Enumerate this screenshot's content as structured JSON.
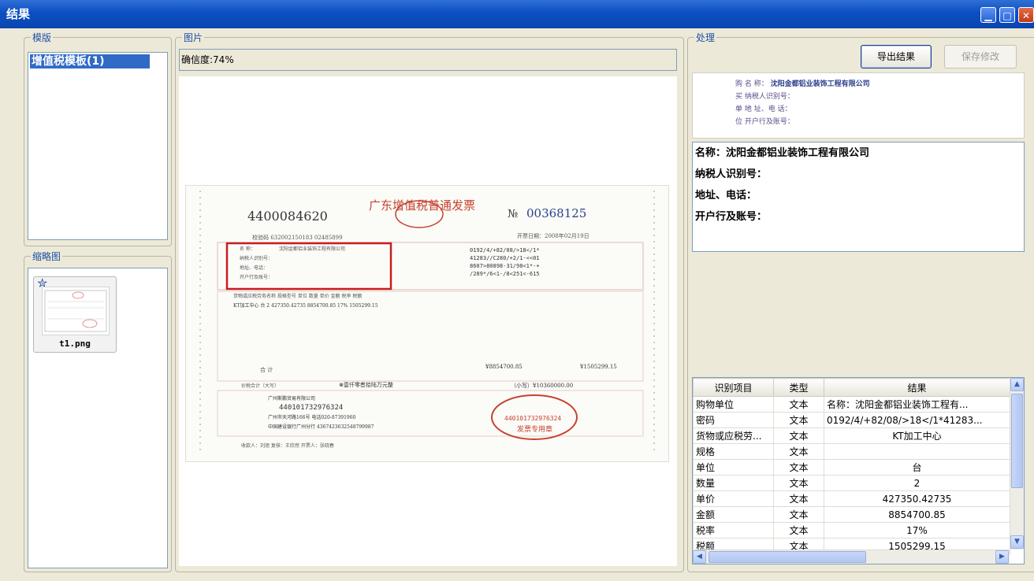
{
  "window": {
    "title": "结果",
    "min_glyph": "▁",
    "max_glyph": "□",
    "close_glyph": "✕"
  },
  "templates": {
    "label": "模版",
    "items": [
      "增值税模板(1)"
    ]
  },
  "thumbnails": {
    "label": "缩略图",
    "items": [
      {
        "caption": "t1.png"
      }
    ]
  },
  "image": {
    "label": "图片",
    "confidence_text": "确信度:74%",
    "invoice": {
      "code": "4400084620",
      "title": "广东增值税普通发票",
      "number_prefix": "№",
      "number": "00368125",
      "check_code": "校验码 632002150183 02485899",
      "date": "开票日期：2008年02月19日",
      "buyer_name_label": "名 称：",
      "buyer_name_value": "沈阳金都铝业装饰工程有限公司",
      "buyer_tax_label": "纳税人识别号：",
      "buyer_addr_label": "地址、电话：",
      "buyer_bank_label": "开户行及账号：",
      "cipher_lines": [
        "0192/4/+82/08/>18</1*",
        "41283//C280/+2/1-<<01",
        "8607>80898-31/98<1*-+",
        "/289*/6<1-/8<251<-615"
      ],
      "item_header": "货物或应税劳务名称    规格型号   单位   数量   单价      金额        税率   税额",
      "item_line": "KT加工中心                        台      2    427350.42735  8854700.85  17%  1505299.15",
      "subtotal_label": "合    计",
      "subtotal_amount": "¥8854700.85",
      "subtotal_tax": "¥1505299.15",
      "total_label": "价税合计（大写）",
      "total_words": "⊗壹仟零叁拾陆万元整",
      "total_small": "（小写）¥10360000.00",
      "seller_name": "广州斯鹏贸易有限公司",
      "seller_tax": "440101732976324",
      "seller_addr": "广州市天河路166号 电话020-87391960",
      "seller_bank": "中国建设银行广州分行 4367423632548799987",
      "stamp_text": "440101732976324",
      "stamp_label": "发票专用章",
      "footer": "收款人：刘旭      复核：王欣然      开票人：张晓春"
    }
  },
  "processing": {
    "label": "处理",
    "export_button": "导出结果",
    "save_button": "保存修改",
    "crop_lines": [
      {
        "label": "购  名        称：",
        "value": "沈阳金都铝业装饰工程有限公司"
      },
      {
        "label": "买  纳税人识别号：",
        "value": ""
      },
      {
        "label": "单  地 址、电 话：",
        "value": ""
      },
      {
        "label": "位  开户行及账号：",
        "value": ""
      }
    ],
    "result_lines": [
      "名称：沈阳金都铝业装饰工程有限公司",
      "纳税人识别号：",
      "地址、电话：",
      "开户行及账号："
    ],
    "table": {
      "headers": [
        "识别项目",
        "类型",
        "结果"
      ],
      "rows": [
        [
          "购物单位",
          "文本",
          "名称：沈阳金都铝业装饰工程有..."
        ],
        [
          "密码",
          "文本",
          "0192/4/+82/08/>18</1*41283..."
        ],
        [
          "货物或应税劳...",
          "文本",
          "KT加工中心"
        ],
        [
          "规格",
          "文本",
          ""
        ],
        [
          "单位",
          "文本",
          "台"
        ],
        [
          "数量",
          "文本",
          "2"
        ],
        [
          "单价",
          "文本",
          "427350.42735"
        ],
        [
          "金额",
          "文本",
          "8854700.85"
        ],
        [
          "税率",
          "文本",
          "17%"
        ],
        [
          "税额",
          "文本",
          "1505299.15"
        ]
      ]
    }
  },
  "colors": {
    "titlebar": "#0c4fc3",
    "selection": "#316ac5",
    "frame": "#ece9d8",
    "stamp": "#c6422e",
    "highlight_box": "#c81e1e"
  }
}
